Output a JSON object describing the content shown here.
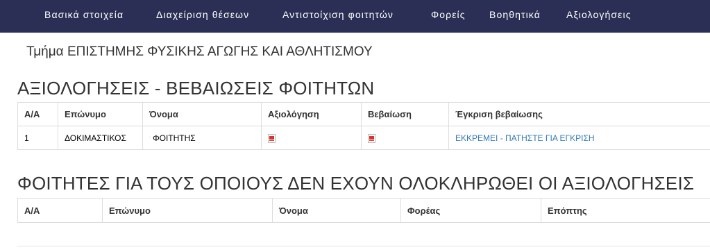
{
  "nav": {
    "items": [
      {
        "label": "Βασικά στοιχεία"
      },
      {
        "label": "Διαχείριση θέσεων"
      },
      {
        "label": "Αντιστοίχιση φοιτητών"
      },
      {
        "label": "Φορείς"
      },
      {
        "label": "Βοηθητικά"
      },
      {
        "label": "Αξιολογήσεις"
      }
    ]
  },
  "department": "Τμήμα ΕΠΙΣΤΗΜΗΣ ΦΥΣΙΚΗΣ ΑΓΩΓΗΣ ΚΑΙ ΑΘΛΗΤΙΣΜΟΥ",
  "evaluations": {
    "title": "ΑΞΙΟΛΟΓΗΣΕΙΣ - ΒΕΒΑΙΩΣΕΙΣ ΦΟΙΤΗΤΩΝ",
    "columns": [
      "Α/Α",
      "Επώνυμο",
      "Όνομα",
      "Αξιολόγηση",
      "Βεβαίωση",
      "Έγκριση βεβαίωσης"
    ],
    "rows": [
      {
        "aa": "1",
        "surname": "ΔΟΚΙΜΑΣΤΙΚΟΣ",
        "name": "ΦΟΙΤΗΤΗΣ",
        "evaluation_icon": "pdf-icon",
        "certificate_icon": "pdf-icon",
        "approval": "ΕΚΚΡΕΜΕΙ - ΠΑΤΗΣΤΕ ΓΙΑ ΕΓΚΡΙΣΗ"
      }
    ]
  },
  "incomplete": {
    "title": "ΦΟΙΤΗΤΕΣ ΓΙΑ ΤΟΥΣ ΟΠΟΙΟΥΣ ΔΕΝ ΕΧΟΥΝ ΟΛΟΚΛΗΡΩΘΕΙ ΟΙ ΑΞΙΟΛΟΓΗΣΕΙΣ",
    "columns": [
      "Α/Α",
      "Επώνυμο",
      "Όνομα",
      "Φορέας",
      "Επόπτης"
    ]
  },
  "colors": {
    "navbar": "#2b2f55",
    "link": "#337ab7",
    "border": "#dddddd"
  }
}
